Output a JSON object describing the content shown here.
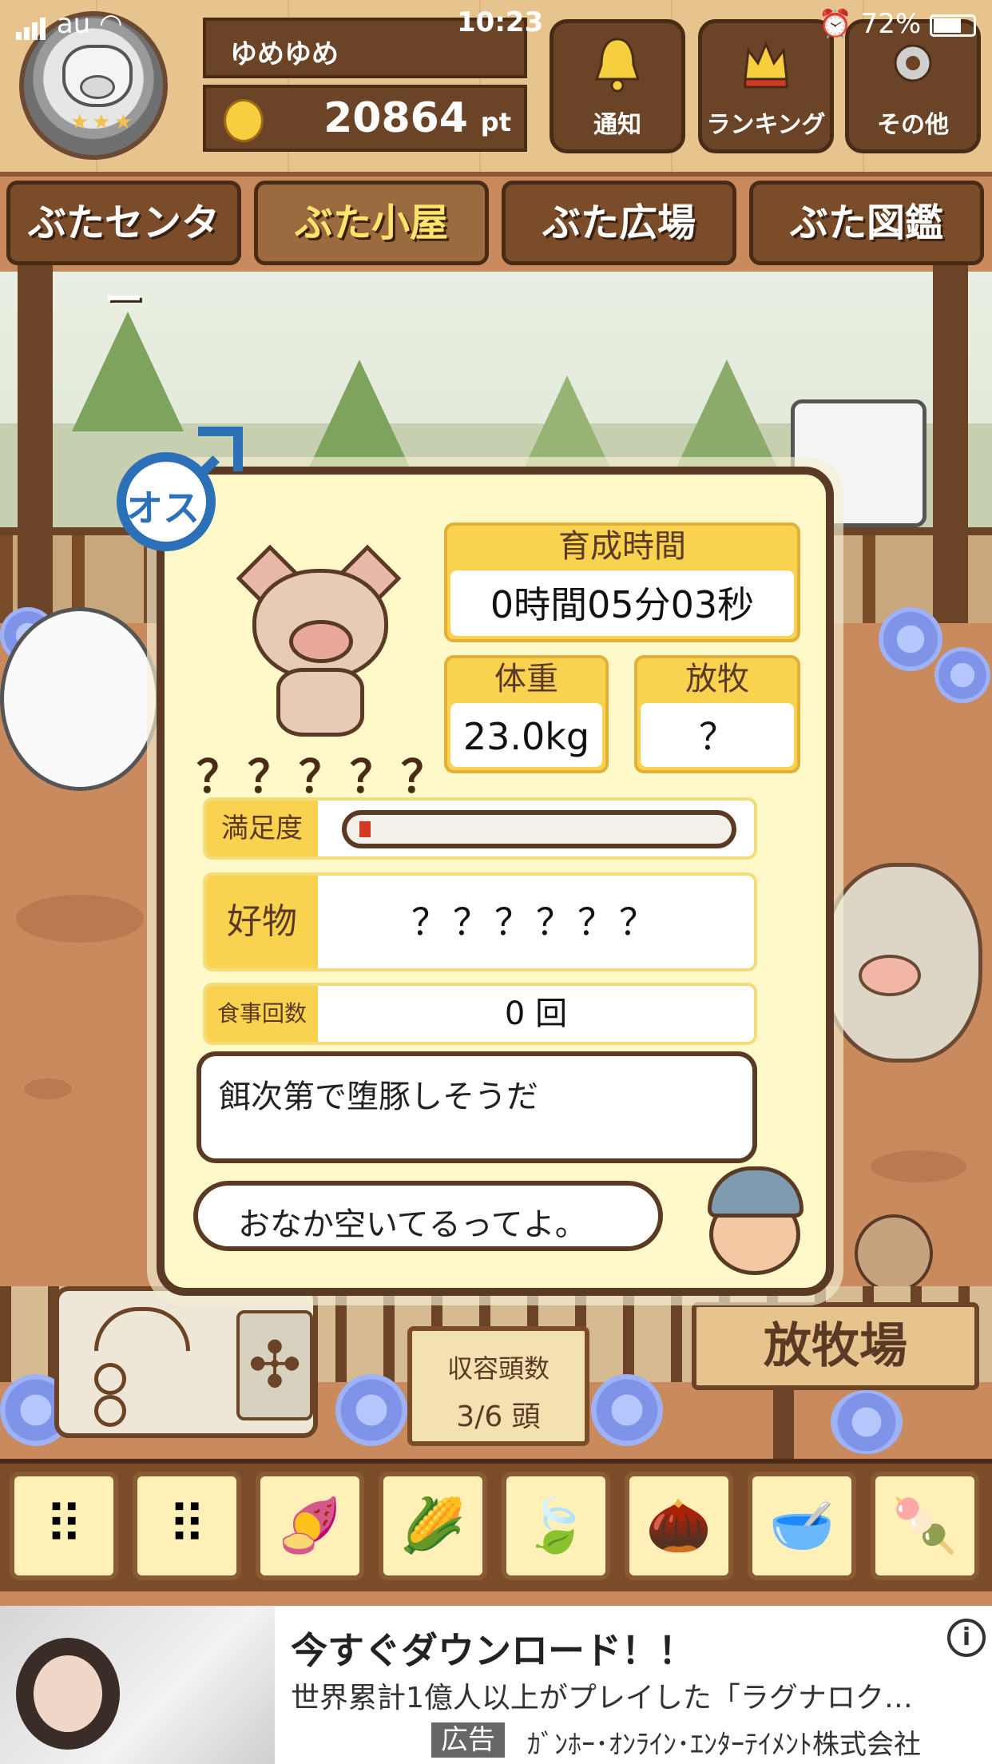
{
  "status_bar": {
    "carrier": "au",
    "time": "10:23",
    "battery": "72%"
  },
  "header": {
    "username": "ゆめゆめ",
    "points": "20864",
    "points_unit": "pt",
    "buttons": [
      {
        "label": "通知",
        "icon": "bell-icon"
      },
      {
        "label": "ランキング",
        "icon": "crown-icon"
      },
      {
        "label": "その他",
        "icon": "gear-icon"
      }
    ]
  },
  "tabs": [
    {
      "label": "ぶたセンター",
      "active": false
    },
    {
      "label": "ぶた小屋",
      "active": true
    },
    {
      "label": "ぶた広場",
      "active": false
    },
    {
      "label": "ぶた図鑑",
      "active": false
    }
  ],
  "pig_card": {
    "gender_label": "オス",
    "name": "？？？？？",
    "growth_time_label": "育成時間",
    "growth_time_value": "0時間05分03秒",
    "weight_label": "体重",
    "weight_value": "23.0kg",
    "grazing_label": "放牧",
    "grazing_value": "？",
    "satisfaction_label": "満足度",
    "satisfaction_level": 0.03,
    "favorite_label": "好物",
    "favorite_value": "？？？？？？",
    "meals_label": "食事回数",
    "meals_value": "0 回",
    "comment": "餌次第で堕豚しそうだ",
    "farmer_line": "おなか空いてるってよ。"
  },
  "capacity": {
    "label": "収容頭数",
    "value": "3/6 頭"
  },
  "pasture_sign": "放牧場",
  "foods": [
    {
      "icon": "grain-pile-icon",
      "glyph": "⠿"
    },
    {
      "icon": "mixed-grain-icon",
      "glyph": "⠿"
    },
    {
      "icon": "sweet-potato-icon",
      "glyph": "🍠"
    },
    {
      "icon": "corn-icon",
      "glyph": "🌽"
    },
    {
      "icon": "beans-leaf-icon",
      "glyph": "🍃"
    },
    {
      "icon": "acorn-icon",
      "glyph": "🌰"
    },
    {
      "icon": "grain-bowl-icon",
      "glyph": "🥣"
    },
    {
      "icon": "meatball-plate-icon",
      "glyph": "🍡"
    }
  ],
  "ad": {
    "title": "今すぐダウンロード！！",
    "text": "世界累計1億人以上がプレイした「ラグナロク…",
    "tag": "広告",
    "sponsor": "ｶﾞﾝﾎｰ･ｵﾝﾗｲﾝ･ｴﾝﾀｰﾃｲﾒﾝﾄ株式会社"
  },
  "colors": {
    "wood_dark": "#6b4428",
    "card_bg": "#fff8c8",
    "label_yellow": "#f9d24f",
    "gender_blue": "#2c71b8",
    "gauge_red": "#d23a24"
  }
}
